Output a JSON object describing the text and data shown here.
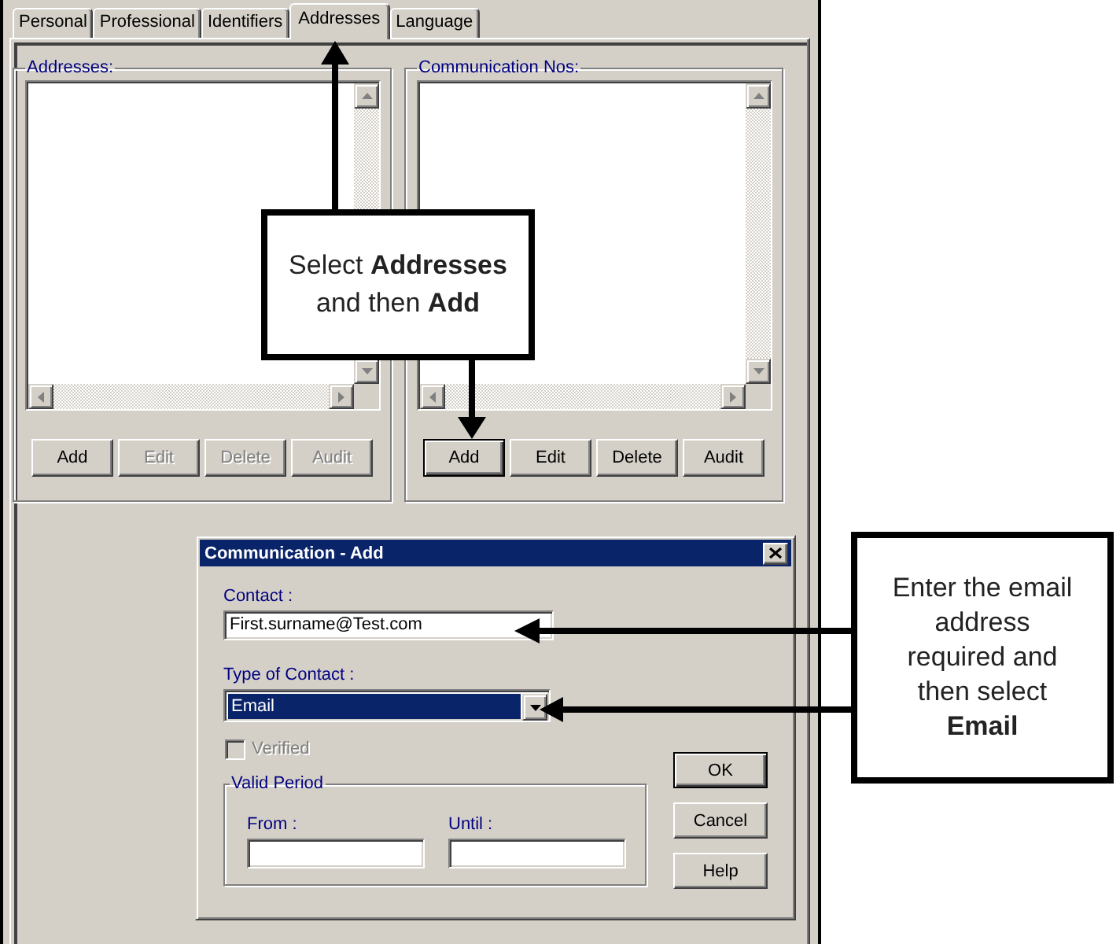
{
  "window": {
    "tabs": [
      {
        "label": "Personal",
        "selected": false
      },
      {
        "label": "Professional",
        "selected": false
      },
      {
        "label": "Identifiers",
        "selected": false
      },
      {
        "label": "Addresses",
        "selected": true
      },
      {
        "label": "Language",
        "selected": false
      }
    ]
  },
  "groups": [
    {
      "title": "Addresses:",
      "buttons": [
        {
          "label": "Add",
          "disabled": false,
          "focused": false
        },
        {
          "label": "Edit",
          "disabled": true,
          "focused": false
        },
        {
          "label": "Delete",
          "disabled": true,
          "focused": false
        },
        {
          "label": "Audit",
          "disabled": true,
          "focused": false
        }
      ]
    },
    {
      "title": "Communication Nos:",
      "buttons": [
        {
          "label": "Add",
          "disabled": false,
          "focused": true
        },
        {
          "label": "Edit",
          "disabled": false,
          "focused": false
        },
        {
          "label": "Delete",
          "disabled": false,
          "focused": false
        },
        {
          "label": "Audit",
          "disabled": false,
          "focused": false
        }
      ]
    }
  ],
  "dialog": {
    "title": "Communication - Add",
    "contact": {
      "label": "Contact :",
      "value": "First.surname@Test.com"
    },
    "type_of_contact": {
      "label": "Type of Contact :",
      "value": "Email",
      "highlighted": true
    },
    "verified": {
      "label": "Verified",
      "checked": false,
      "disabled": true
    },
    "valid_period": {
      "title": "Valid Period",
      "fields": [
        {
          "label": "From :"
        },
        {
          "label": "Until :"
        }
      ]
    },
    "buttons": [
      {
        "label": "OK",
        "default": true
      },
      {
        "label": "Cancel",
        "default": false
      },
      {
        "label": "Help",
        "default": false
      }
    ]
  },
  "callouts": [
    {
      "text": "Select **Addresses** and then **Add**"
    },
    {
      "text": "Enter the email address required and then select **Email**"
    }
  ]
}
